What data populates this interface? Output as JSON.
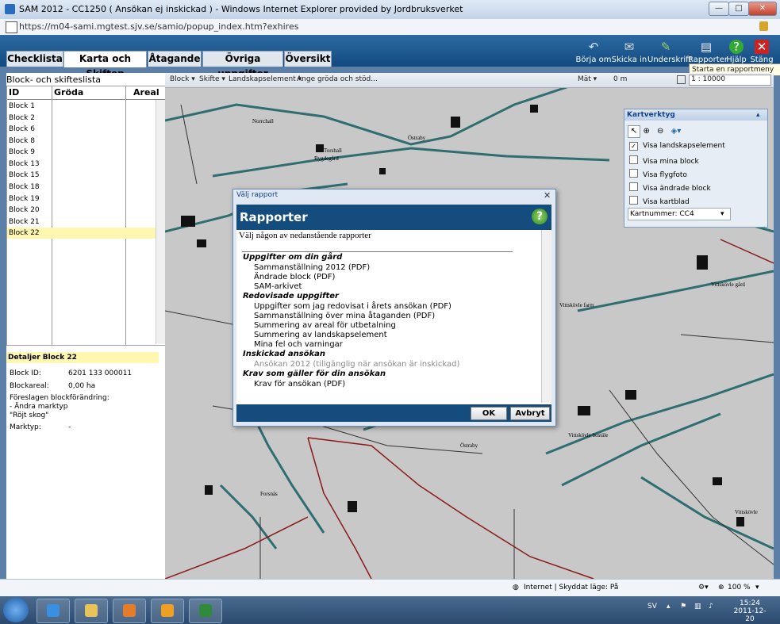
{
  "window": {
    "title": "SAM 2012 - CC1250 ( Ansökan ej inskickad ) - Windows Internet Explorer provided by Jordbruksverket",
    "min": "—",
    "max": "□",
    "close": "✕"
  },
  "address": {
    "url": "https://m04-sami.mgtest.sjv.se/samio/popup_index.htm?exhires"
  },
  "tabs": [
    {
      "label": "Checklista"
    },
    {
      "label": "Karta och Skiften"
    },
    {
      "label": "Åtagande"
    },
    {
      "label": "Övriga uppgifter"
    },
    {
      "label": "Översikt"
    }
  ],
  "toolbar": {
    "borja_om": "Börja om",
    "skicka_in": "Skicka in",
    "underskrift": "Underskrift",
    "rapporter": "Rapporter",
    "hjalp": "Hjälp",
    "stang": "Stäng"
  },
  "tooltip": "Starta en rapportmeny",
  "left": {
    "title": "Block- och skifteslista",
    "columns": [
      "ID",
      "Gröda",
      "Areal"
    ],
    "rows": [
      "Block 1",
      "Block 2",
      "Block 6",
      "Block 8",
      "Block 9",
      "Block 13",
      "Block 15",
      "Block 18",
      "Block 19",
      "Block 20",
      "Block 21",
      "Block 22"
    ],
    "selected": "Block 22"
  },
  "details": {
    "title": "Detaljer Block 22",
    "block_id_label": "Block ID:",
    "block_id": "6201 133 000011",
    "blockareal_label": "Blockareal:",
    "blockareal": "0,00 ha",
    "forslag_label": "Föreslagen blockförändring:",
    "forslag_1": "- Ändra marktyp",
    "forslag_2": "\"Röjt skog\"",
    "marktyp_label": "Marktyp:",
    "marktyp": "-"
  },
  "maptoolbar": {
    "block": "Block ▾",
    "skifte": "Skifte ▾",
    "landskap": "Landskapselement ▾",
    "grodan": "Ange gröda och stöd...",
    "mat": "Mät ▾",
    "meter": "0 m",
    "scale": "1 : 10000"
  },
  "places": [
    "Norrchall",
    "Torshall",
    "Bygdegård",
    "Östraby",
    "Vittskövle gård",
    "Vittskövle farm",
    "Vittskövle bostäle",
    "Östraby",
    "Forsnäs",
    "Vittskövle"
  ],
  "kart": {
    "title": "Kartverktyg",
    "items": [
      {
        "label": "Visa landskapselement",
        "checked": "✓"
      },
      {
        "label": "Visa mina block",
        "checked": ""
      },
      {
        "label": "Visa flygfoto",
        "checked": ""
      },
      {
        "label": "Visa ändrade block",
        "checked": ""
      },
      {
        "label": "Visa kartblad",
        "checked": ""
      }
    ],
    "kartnummer": "Kartnummer: CC4"
  },
  "dialog": {
    "title": "Välj rapport",
    "close": "✕",
    "banner": "Rapporter",
    "help": "?",
    "intro": "Välj någon av nedanstående rapporter",
    "items": [
      {
        "text": "Uppgifter om din gård",
        "kind": "sec"
      },
      {
        "text": "Sammanställning 2012  (PDF)",
        "kind": "item1"
      },
      {
        "text": "Ändrade block   (PDF)",
        "kind": "item1"
      },
      {
        "text": "SAM-arkivet",
        "kind": "item1"
      },
      {
        "text": "Redovisade uppgifter",
        "kind": "sec"
      },
      {
        "text": "Uppgifter som jag redovisat i årets ansökan  (PDF)",
        "kind": "item2"
      },
      {
        "text": "Sammanställning över mina åtaganden  (PDF)",
        "kind": "item2"
      },
      {
        "text": "Summering av areal för utbetalning",
        "kind": "item2"
      },
      {
        "text": "Summering av landskapselement",
        "kind": "item2"
      },
      {
        "text": "Mina fel och varningar",
        "kind": "item2"
      },
      {
        "text": "Inskickad ansökan",
        "kind": "sec"
      },
      {
        "text": "Ansökan 2012 (tillgänglig när ansökan är inskickad)",
        "kind": "dis"
      },
      {
        "text": "Krav som gäller för din ansökan",
        "kind": "sec"
      },
      {
        "text": "Krav för ansökan   (PDF)",
        "kind": "item2"
      }
    ],
    "ok": "OK",
    "cancel": "Avbryt"
  },
  "status": {
    "zone": "Internet | Skyddat läge: På",
    "zoom": "100 %"
  },
  "taskbar": {
    "lang": "SV",
    "time": "15:24",
    "date": "2011-12-20"
  },
  "colors": {
    "header_blue": "#124a7f",
    "road_teal": "#2f6e70",
    "selection_yellow": "#fff6b0",
    "boundary_red": "#8b1a1a"
  }
}
